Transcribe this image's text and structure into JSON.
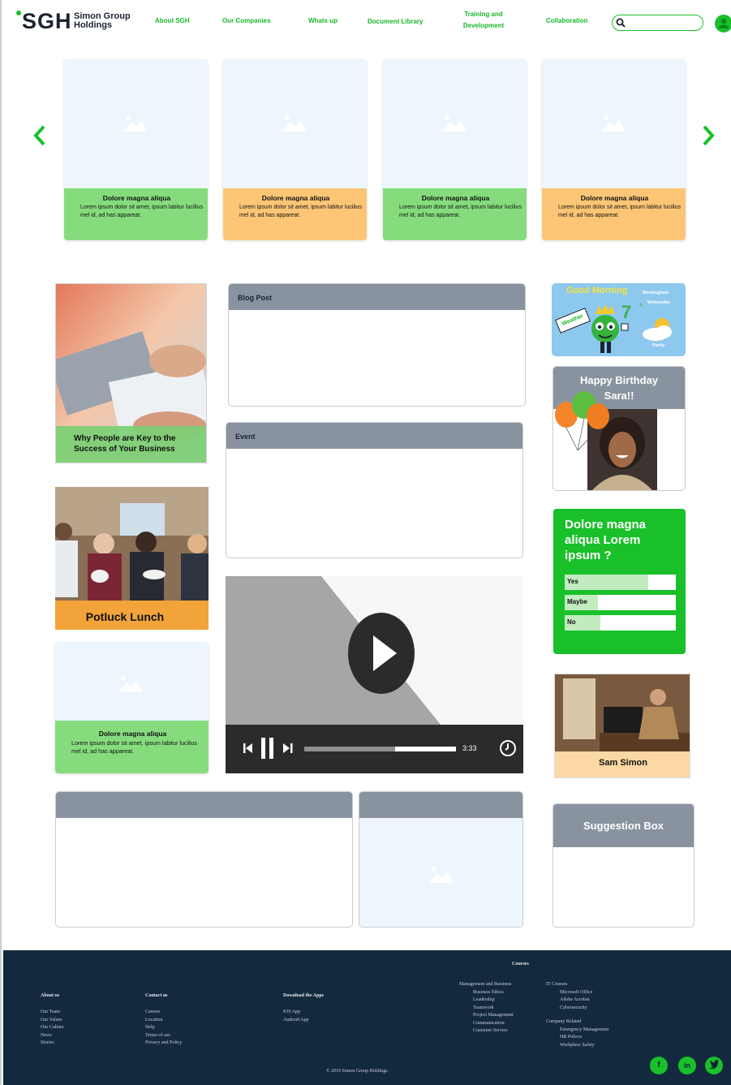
{
  "header": {
    "logo_mark": "SGH",
    "logo_name_1": "Simon Group",
    "logo_name_2": "Holdings",
    "nav": [
      "About SGH",
      "Our Companies",
      "Whats up",
      "Document Library",
      "Training and",
      "Development",
      "Collaboration"
    ],
    "search_placeholder": ""
  },
  "carousel": {
    "cards": [
      {
        "title": "Dolore magna aliqua",
        "text": "Lorem ipsum dolor sit amet, ipsum labitur lucilius mel id, ad has appareat.",
        "color": "#86dc7d"
      },
      {
        "title": "Dolore magna aliqua",
        "text": "Lorem ipsum dolor sit amet, ipsum labitur lucilius mel id, ad has appareat.",
        "color": "#fcc676"
      },
      {
        "title": "Dolore magna aliqua",
        "text": "Lorem ipsum dolor sit amet, ipsum labitur lucilius mel id, ad has appareat.",
        "color": "#86dc7d"
      },
      {
        "title": "Dolore magna aliqua",
        "text": "Lorem ipsum dolor sit amet, ipsum labitur lucilius mel id, ad has appareat.",
        "color": "#fcc676"
      }
    ],
    "prev_icon": "chevron-left-icon",
    "next_icon": "chevron-right-icon"
  },
  "left": {
    "article_title": "Why People are Key to the Success of Your Business",
    "potluck_title": "Potluck Lunch",
    "card_title": "Dolore magna aliqua",
    "card_text": "Lorem ipsum dolor sit amet, ipsum labitur lucilius mel id, ad has appareat."
  },
  "center": {
    "blog_title": "Blog Post",
    "event_title": "Event",
    "video_time": "3:33",
    "video_progress": 0.6
  },
  "right": {
    "weather": {
      "greeting": "Good Morning",
      "city": "Birmingham",
      "day": "Wednesday",
      "temp": "7",
      "unit": "°",
      "sign": "Weather",
      "condition": "Partly"
    },
    "birthday": {
      "title": "Happy Birthday",
      "name": "Sara!!"
    },
    "poll": {
      "question": "Dolore magna aliqua Lorem ipsum ?",
      "options": [
        {
          "label": "Yes",
          "share": 0.75
        },
        {
          "label": "Maybe",
          "share": 0.3
        },
        {
          "label": "No",
          "share": 0.32
        }
      ]
    },
    "person_name": "Sam Simon",
    "suggestion_title": "Suggestion Box"
  },
  "footer": {
    "courses_heading": "Courses",
    "about": {
      "heading": "About us",
      "links": [
        "Our Team",
        "Our Values",
        "Our Culture",
        "News",
        "Stories"
      ]
    },
    "contact": {
      "heading": "Contact us",
      "links": [
        "Careers",
        "Location",
        "Help",
        "Terms of use",
        "Privacy and Policy"
      ]
    },
    "apps": {
      "heading": "Download the Apps",
      "links": [
        "IOS App",
        "Android App"
      ]
    },
    "mgmt": {
      "heading": "Management and Business",
      "links": [
        "Business Ethics",
        "Leadership",
        "Teamwork",
        "Project Management",
        "Communication",
        "Customer Service"
      ]
    },
    "it": {
      "heading": "IT Courses",
      "links": [
        "Microsoft Office",
        "Adobe Acrobat",
        "Cybersecurity"
      ]
    },
    "company": {
      "heading": "Company Related",
      "links": [
        "Emergency Management",
        "HR Polices",
        "Workplace Safety"
      ]
    },
    "copyright": "© 2019 Simon Group Holdings",
    "social": [
      "f",
      "in",
      "t"
    ]
  }
}
